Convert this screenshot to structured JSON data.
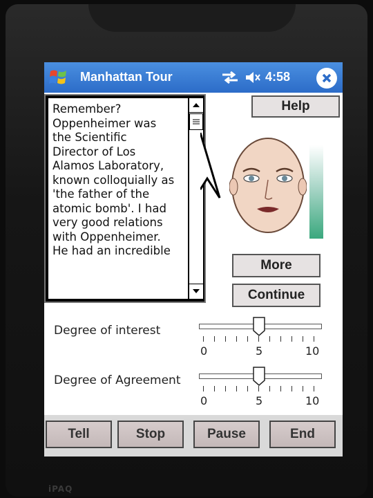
{
  "app": {
    "title": "Manhattan Tour",
    "clock": "4:58"
  },
  "speech": {
    "lines": [
      "Remember?",
      "Oppenheimer was",
      "the Scientific",
      "Director of Los",
      "Alamos Laboratory,",
      "known colloquially as",
      "'the father of the",
      "atomic bomb'. I had",
      "very good relations",
      "with Oppenheimer.",
      "He had an incredible"
    ]
  },
  "buttons": {
    "help": "Help",
    "more": "More",
    "continue": "Continue"
  },
  "sliders": [
    {
      "label": "Degree of interest",
      "min": "0",
      "mid": "5",
      "max": "10",
      "value": 5
    },
    {
      "label": "Degree of Agreement",
      "min": "0",
      "mid": "5",
      "max": "10",
      "value": 5
    }
  ],
  "bottom": {
    "tell": "Tell",
    "stop": "Stop",
    "pause": "Pause",
    "end": "End"
  },
  "icons": {
    "start": "windows-flag-icon",
    "connectivity": "connectivity-arrows-icon",
    "volume": "speaker-muted-icon",
    "close": "close-x-icon"
  },
  "colors": {
    "titlebar": "#2c6cc8",
    "level": "#3aa87e"
  }
}
